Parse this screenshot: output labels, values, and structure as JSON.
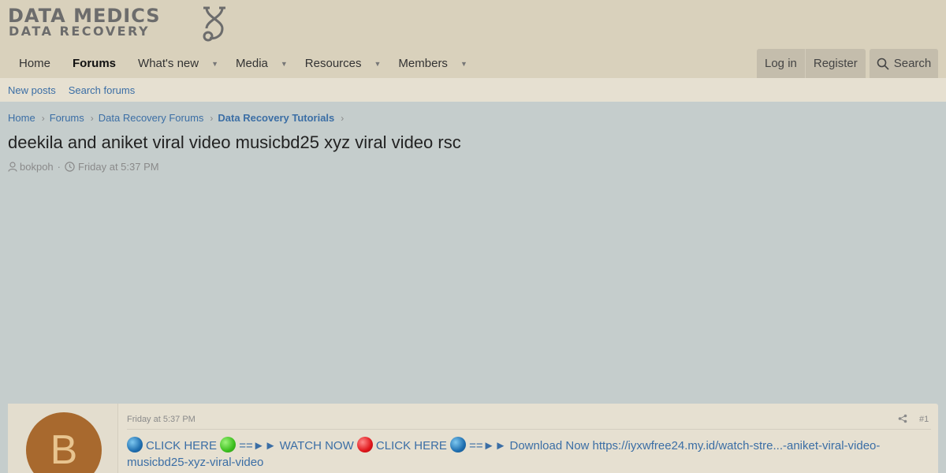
{
  "logo": {
    "line1": "DATA MEDICS",
    "line2": "DATA RECOVERY"
  },
  "nav": {
    "items": [
      {
        "label": "Home",
        "active": false,
        "caret": false
      },
      {
        "label": "Forums",
        "active": true,
        "caret": false
      },
      {
        "label": "What's new",
        "active": false,
        "caret": true
      },
      {
        "label": "Media",
        "active": false,
        "caret": true
      },
      {
        "label": "Resources",
        "active": false,
        "caret": true
      },
      {
        "label": "Members",
        "active": false,
        "caret": true
      }
    ],
    "login": "Log in",
    "register": "Register",
    "search": "Search"
  },
  "subnav": {
    "new_posts": "New posts",
    "search_forums": "Search forums"
  },
  "breadcrumb": [
    "Home",
    "Forums",
    "Data Recovery Forums",
    "Data Recovery Tutorials"
  ],
  "thread": {
    "title": "deekila and aniket viral video musicbd25 xyz viral video rsc",
    "author": "bokpoh",
    "date": "Friday at 5:37 PM"
  },
  "post": {
    "avatar_letter": "B",
    "date": "Friday at 5:37 PM",
    "number": "#1",
    "seg1": "CLICK HERE",
    "seg2": "==►► WATCH NOW",
    "seg3": "CLICK HERE",
    "seg4": "==►► Download Now https://iyxwfree24.my.id/watch-stre...-aniket-viral-video-musicbd25-xyz-viral-video"
  },
  "colors": {
    "header_bg": "#d9d1bc",
    "link": "#3b6ea5",
    "avatar_bg": "#a8692e"
  }
}
